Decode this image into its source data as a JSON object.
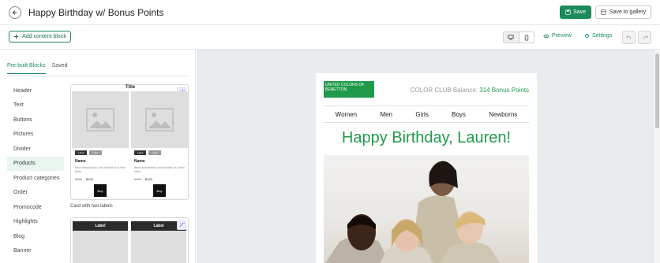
{
  "header": {
    "title": "Happy Birthday w/ Bonus Points",
    "save_label": "Save",
    "save_gallery_label": "Save to gallery"
  },
  "toolbar": {
    "add_block_label": "Add content block",
    "preview_label": "Preview",
    "settings_label": "Settings"
  },
  "left_panel": {
    "tabs": [
      {
        "label": "Pre-built Blocks",
        "active": true
      },
      {
        "label": "Saved",
        "active": false
      }
    ],
    "categories": [
      {
        "label": "Header"
      },
      {
        "label": "Text"
      },
      {
        "label": "Buttons"
      },
      {
        "label": "Pictures"
      },
      {
        "label": "Divider"
      },
      {
        "label": "Products",
        "active": true
      },
      {
        "label": "Product categories"
      },
      {
        "label": "Order"
      },
      {
        "label": "Promocode"
      },
      {
        "label": "Highlights"
      },
      {
        "label": "Blog"
      },
      {
        "label": "Banner"
      }
    ],
    "block_card": {
      "title": "Title",
      "caption": "Card with two labels",
      "products": [
        {
          "label_1": "Label",
          "label_2": "Label",
          "name": "Name",
          "description": "Item description and details in a few lines",
          "old_price": "$250",
          "price": "$199",
          "button": "Buy"
        },
        {
          "label_1": "Label",
          "label_2": "Label",
          "name": "Name",
          "description": "Item description and details in a few lines",
          "old_price": "$250",
          "price": "$199",
          "button": "Buy"
        }
      ]
    },
    "block_card_2": {
      "labels": [
        "Label",
        "Label"
      ]
    }
  },
  "email": {
    "brand_logo_text": "UNITED COLORS OF BENETTON.",
    "club_prefix": "COLOR CLUB Balance: ",
    "club_points": "314 Bonus Points",
    "menu": [
      "Women",
      "Men",
      "Girls",
      "Boys",
      "Newborns"
    ],
    "greeting": "Happy Birthday, Lauren!"
  },
  "colors": {
    "accent": "#1c8a5b",
    "brand_green": "#1f9a4a",
    "canvas_bg": "#e8ecef"
  }
}
